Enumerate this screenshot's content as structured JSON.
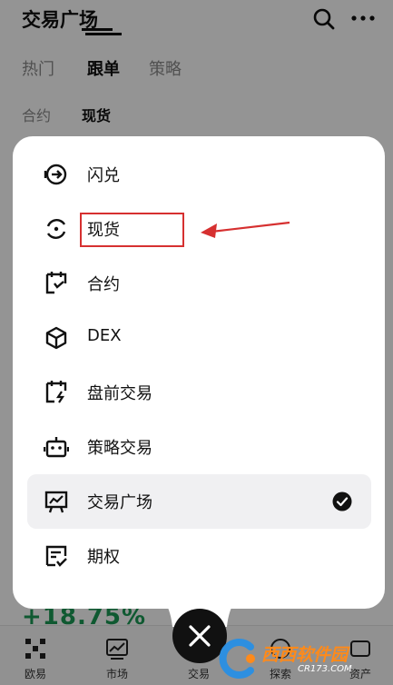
{
  "header": {
    "title": "交易广场",
    "search_icon": "search-icon",
    "more_icon": "more-icon"
  },
  "tabs": [
    {
      "label": "热门"
    },
    {
      "label": "跟单"
    },
    {
      "label": "策略"
    }
  ],
  "active_tab": "跟单",
  "sub_tabs": [
    {
      "label": "合约"
    },
    {
      "label": "现货"
    }
  ],
  "active_sub_tab": "现货",
  "background_value": "+18.75%",
  "menu": {
    "items": [
      {
        "label": "闪兑",
        "icon": "swap-icon"
      },
      {
        "label": "现货",
        "icon": "spot-icon"
      },
      {
        "label": "合约",
        "icon": "futures-icon"
      },
      {
        "label": "DEX",
        "icon": "cube-icon"
      },
      {
        "label": "盘前交易",
        "icon": "premarket-icon"
      },
      {
        "label": "策略交易",
        "icon": "bot-icon"
      },
      {
        "label": "交易广场",
        "icon": "chart-board-icon",
        "selected": true
      },
      {
        "label": "期权",
        "icon": "options-icon"
      }
    ]
  },
  "bottom_nav": [
    {
      "label": "欧易",
      "icon": "okx-logo-icon"
    },
    {
      "label": "市场",
      "icon": "market-chart-icon"
    },
    {
      "label": "交易",
      "icon": "trade-icon"
    },
    {
      "label": "探索",
      "icon": "explore-icon"
    },
    {
      "label": "资产",
      "icon": "assets-icon"
    }
  ],
  "watermark": {
    "main": "西西软件园",
    "sub": "CR173.COM"
  },
  "colors": {
    "accent": "#111111",
    "highlight": "#d63030",
    "positive": "#1a9a55"
  }
}
